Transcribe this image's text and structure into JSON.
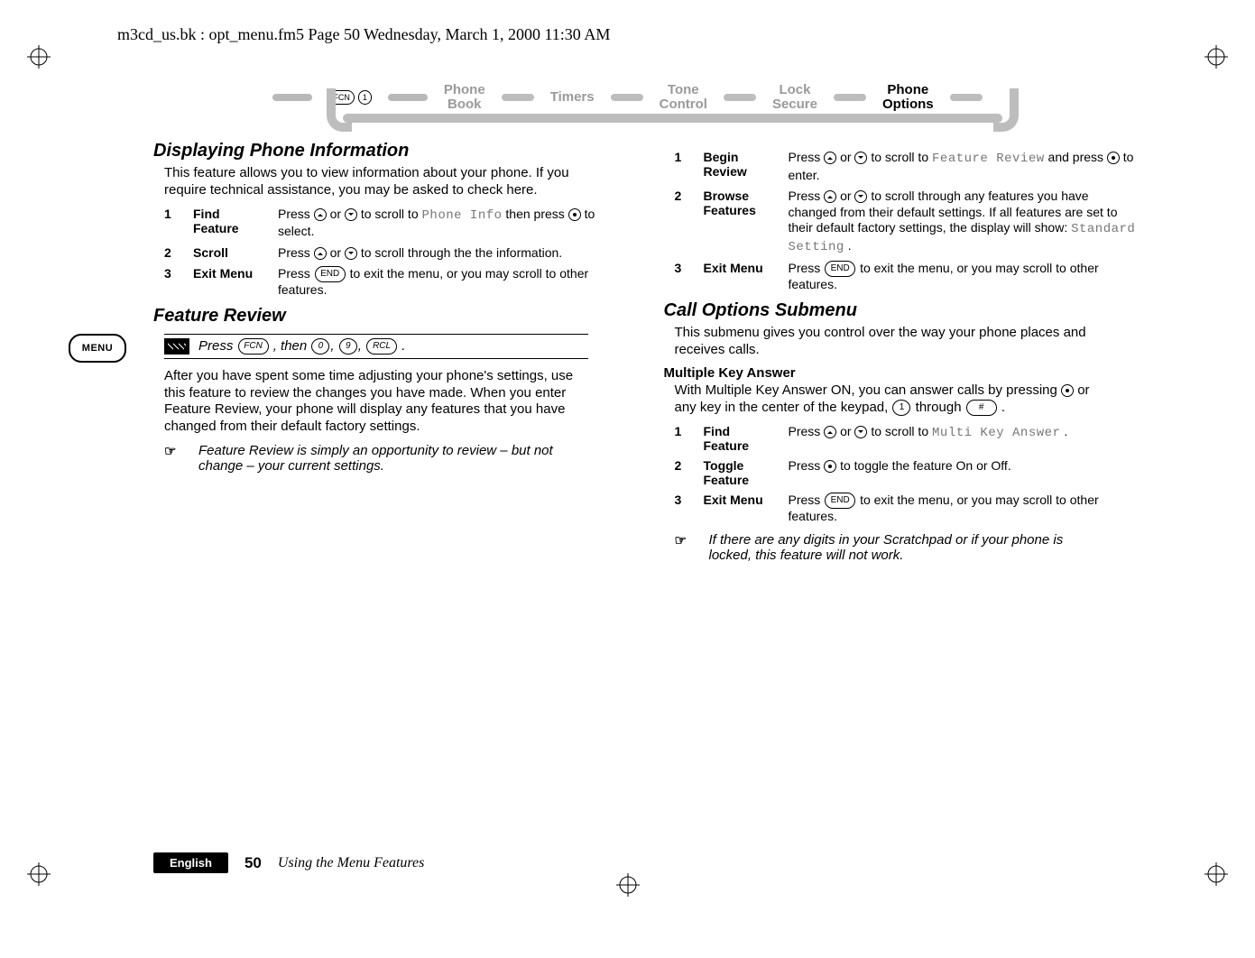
{
  "header_line": "m3cd_us.bk : opt_menu.fm5  Page 50  Wednesday, March 1, 2000  11:30 AM",
  "nav": {
    "fcn_label": "FCN",
    "one_label": "1",
    "items": [
      {
        "line1": "Phone",
        "line2": "Book",
        "active": false
      },
      {
        "line1": "Timers",
        "line2": "",
        "active": false
      },
      {
        "line1": "Tone",
        "line2": "Control",
        "active": false
      },
      {
        "line1": "Lock",
        "line2": "Secure",
        "active": false
      },
      {
        "line1": "Phone",
        "line2": "Options",
        "active": true
      }
    ]
  },
  "menu_tab": "MENU",
  "left": {
    "h_display": "Displaying Phone Information",
    "display_text": "This feature allows you to view information about your phone. If you require technical assistance, you may be asked to check here.",
    "display_steps": [
      {
        "n": "1",
        "label": "Find Feature",
        "desc_pre": "Press ",
        "desc_mid": " to scroll to ",
        "lcd": "Phone Info",
        "desc_post": " then press ",
        "desc_end": " to select."
      },
      {
        "n": "2",
        "label": "Scroll",
        "desc_pre": "Press ",
        "desc_mid": " to scroll through the the information.",
        "lcd": "",
        "desc_post": "",
        "desc_end": ""
      },
      {
        "n": "3",
        "label": "Exit Menu",
        "desc_pre": "Press ",
        "key": "END",
        "desc_mid": " to exit the menu, or you may scroll to other features.",
        "lcd": "",
        "desc_post": "",
        "desc_end": ""
      }
    ],
    "h_feature": "Feature Review",
    "shortcut": {
      "prefix": "Press ",
      "k1": "FCN",
      "mid": ", then ",
      "k2": "0",
      "k3": "9",
      "k4": "RCL",
      "suffix": "."
    },
    "feature_text": "After you have spent some time adjusting your phone's settings, use this feature to review the changes you have made. When you enter Feature Review, your phone will display any features that you have changed from their default factory settings.",
    "feature_note": "Feature Review is simply an opportunity to review – but not change – your current settings."
  },
  "right": {
    "review_steps": [
      {
        "n": "1",
        "label": "Begin Review",
        "desc_pre": "Press ",
        "desc_mid": " to scroll to ",
        "lcd": "Feature Review",
        "desc_post": " and press ",
        "desc_end": " to enter."
      },
      {
        "n": "2",
        "label": "Browse Features",
        "desc_pre": "Press ",
        "desc_mid": " to scroll through any features you have changed from their default settings. If all features are set to their default factory settings, the display will show: ",
        "lcd": "Standard Setting",
        "desc_post": ".",
        "desc_end": ""
      },
      {
        "n": "3",
        "label": "Exit Menu",
        "desc_pre": "Press ",
        "key": "END",
        "desc_mid": " to exit the menu, or you may scroll to other features.",
        "lcd": "",
        "desc_post": "",
        "desc_end": ""
      }
    ],
    "h_call": "Call Options Submenu",
    "call_text": "This submenu gives you control over the way your phone places and receives calls.",
    "h_mka": "Multiple Key Answer",
    "mka_text_pre": "With Multiple Key Answer ON, you can answer calls by pressing ",
    "mka_text_mid": " or any key in the center of the keypad, ",
    "mka_k1": "1",
    "mka_text_mid2": " through ",
    "mka_k2": "#",
    "mka_text_post": ".",
    "mka_steps": [
      {
        "n": "1",
        "label": "Find Feature",
        "desc_pre": "Press ",
        "desc_mid": " to scroll to ",
        "lcd": "Multi Key Answer",
        "desc_post": ".",
        "desc_end": ""
      },
      {
        "n": "2",
        "label": "Toggle Feature",
        "desc_pre": "Press ",
        "desc_mid": " to toggle the feature On or Off.",
        "lcd": "",
        "desc_post": "",
        "desc_end": ""
      },
      {
        "n": "3",
        "label": "Exit Menu",
        "desc_pre": "Press ",
        "key": "END",
        "desc_mid": " to exit the menu, or you may scroll to other features.",
        "lcd": "",
        "desc_post": "",
        "desc_end": ""
      }
    ],
    "mka_note": "If there are any digits in your Scratchpad or if your phone is locked, this feature will not work."
  },
  "footer": {
    "lang": "English",
    "page": "50",
    "label": "Using the Menu Features"
  },
  "icons": {
    "note": "☞"
  }
}
